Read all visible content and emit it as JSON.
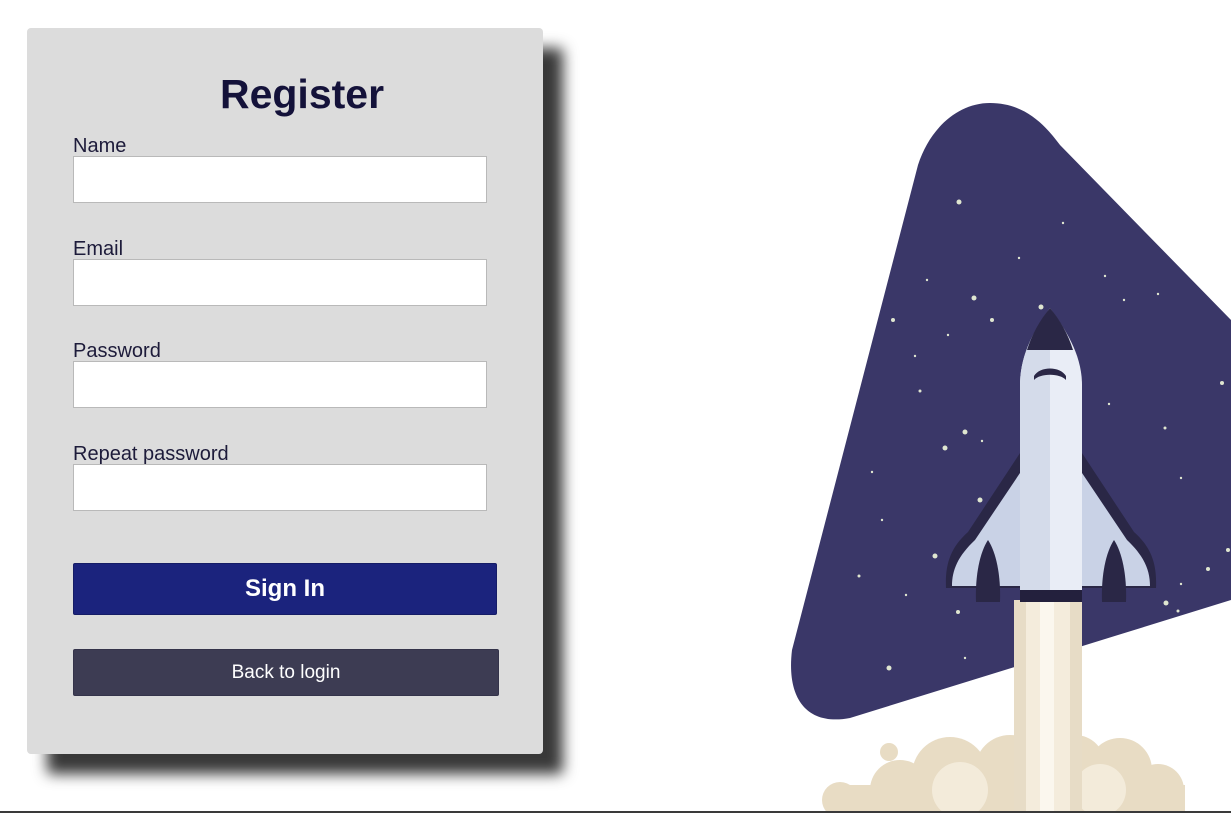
{
  "form": {
    "title": "Register",
    "fields": [
      {
        "label": "Name",
        "value": "",
        "type": "text"
      },
      {
        "label": "Email",
        "value": "",
        "type": "email"
      },
      {
        "label": "Password",
        "value": "",
        "type": "password"
      },
      {
        "label": "Repeat password",
        "value": "",
        "type": "password"
      }
    ],
    "submit_label": "Sign In",
    "back_label": "Back to login"
  },
  "colors": {
    "card_background": "#dcdcdc",
    "title_text": "#14123a",
    "primary_button": "#1b237d",
    "secondary_button": "#3d3c53",
    "illustration_sky": "#3a3768"
  },
  "illustration": {
    "icon": "rocket-launch-icon"
  }
}
